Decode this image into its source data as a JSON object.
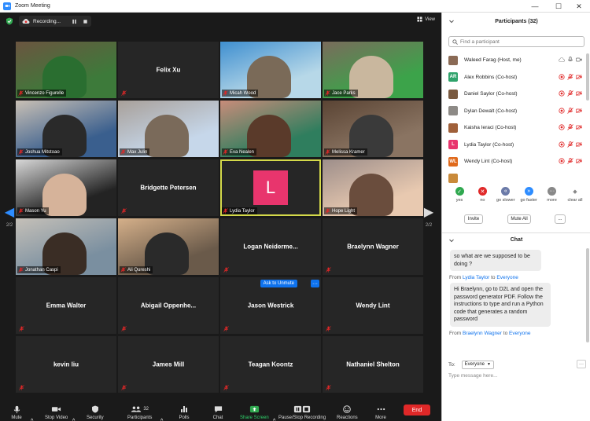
{
  "window": {
    "title": "Zoom Meeting"
  },
  "recording": {
    "text": "Recording..."
  },
  "view_label": "View",
  "pager": {
    "left": "2/2",
    "right": "2/2"
  },
  "tiles": [
    {
      "name": "Vincenzo Figurelle",
      "type": "video"
    },
    {
      "name": "Felix Xu",
      "type": "name"
    },
    {
      "name": "Micah Wood",
      "type": "video"
    },
    {
      "name": "Jace Parks",
      "type": "video"
    },
    {
      "name": "Joshua Mitstoao",
      "type": "video"
    },
    {
      "name": "Max Julin",
      "type": "video"
    },
    {
      "name": "Eva Nealen",
      "type": "video"
    },
    {
      "name": "Melissa Kramer",
      "type": "video"
    },
    {
      "name": "Mason Yu",
      "type": "video"
    },
    {
      "name": "Bridgette Petersen",
      "type": "name"
    },
    {
      "name": "Lydia Taylor",
      "type": "avatar",
      "initial": "L"
    },
    {
      "name": "Hope Light",
      "type": "video"
    },
    {
      "name": "Jonathan Caspi",
      "type": "video"
    },
    {
      "name": "Ali Qureshi",
      "type": "video"
    },
    {
      "name": "Logan  Neiderme...",
      "type": "name"
    },
    {
      "name": "Braelynn Wagner",
      "type": "name"
    },
    {
      "name": "Emma  Walter",
      "type": "name"
    },
    {
      "name": "Abigail  Oppenhe...",
      "type": "name"
    },
    {
      "name": "Jason Westrick",
      "type": "name"
    },
    {
      "name": "Wendy Lint",
      "type": "name"
    },
    {
      "name": "kevin liu",
      "type": "name"
    },
    {
      "name": "James Mill",
      "type": "name"
    },
    {
      "name": "Teagan Koontz",
      "type": "name"
    },
    {
      "name": "Nathaniel Shelton",
      "type": "name"
    }
  ],
  "ask_unmute": {
    "label": "Ask to Unmute",
    "more": "···"
  },
  "toolbar": {
    "mute": "Mute",
    "stop_video": "Stop Video",
    "security": "Security",
    "participants": "Participants",
    "participants_count": "32",
    "polls": "Polls",
    "chat": "Chat",
    "share_screen": "Share Screen",
    "recording": "Pause/Stop Recording",
    "reactions": "Reactions",
    "more": "More",
    "end": "End"
  },
  "participants_panel": {
    "title": "Participants (32)",
    "search_placeholder": "Find a participant",
    "list": [
      {
        "name": "Waleed Farag (Host, me)",
        "avatar": "",
        "color": "#8a6a55"
      },
      {
        "name": "Alex Robbins (Co-host)",
        "avatar": "AR",
        "color": "#2fa36b"
      },
      {
        "name": "Daniel Saylor (Co-host)",
        "avatar": "",
        "color": "#7a5a40"
      },
      {
        "name": "Dylan Dewalt (Co-host)",
        "avatar": "",
        "color": "#8d8a86"
      },
      {
        "name": "Kaisha Ieraci (Co-host)",
        "avatar": "",
        "color": "#a0603a"
      },
      {
        "name": "Lydia Taylor (Co-host)",
        "avatar": "L",
        "color": "#e8356d"
      },
      {
        "name": "Wendy Lint (Co-host)",
        "avatar": "WL",
        "color": "#e06a1c"
      },
      {
        "name": "",
        "avatar": "",
        "color": "#c98a3a"
      }
    ],
    "reactions": [
      {
        "label": "yes",
        "color": "#2fa84f",
        "glyph": "✓"
      },
      {
        "label": "no",
        "color": "#e02828",
        "glyph": "✕"
      },
      {
        "label": "go slower",
        "color": "#6b7aa8",
        "glyph": "«"
      },
      {
        "label": "go faster",
        "color": "#2d8cff",
        "glyph": "»"
      },
      {
        "label": "more",
        "color": "#888",
        "glyph": "···"
      },
      {
        "label": "clear all",
        "color": "#fff",
        "glyph": "◆"
      }
    ],
    "invite": "Invite",
    "mute_all": "Mute All",
    "more": "..."
  },
  "chat": {
    "title": "Chat",
    "messages": [
      {
        "from": "",
        "to": "",
        "text": "so what are we supposed to be doing ?"
      },
      {
        "from": "Lydia Taylor",
        "to": "Everyone",
        "text": "Hi Braelynn, go to D2L and open the password generator PDF. Follow the instructions to type and run a Python code that generates a random password"
      },
      {
        "from": "Braelynn Wagner",
        "to": "Everyone",
        "text": ""
      }
    ],
    "from_word": "From",
    "to_word": "to",
    "to_label": "To:",
    "to_value": "Everyone",
    "input_placeholder": "Type message here..."
  }
}
